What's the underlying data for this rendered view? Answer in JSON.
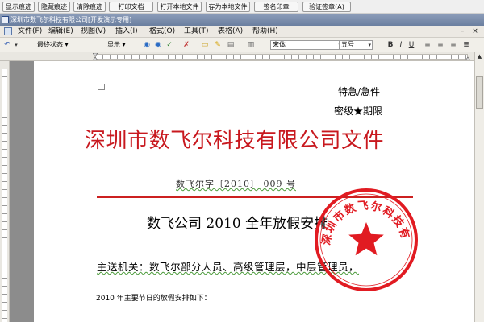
{
  "top_buttons": [
    "显示痕迹",
    "隐藏痕迹",
    "清除痕迹",
    "打印文档",
    "打开本地文件",
    "存为本地文件",
    "签名印章",
    "验证签章(A)"
  ],
  "window_title": "深圳市数飞尔科技有限公司[开发演示专用]",
  "menu": [
    "文件(F)",
    "编辑(E)",
    "视图(V)",
    "插入(I)",
    "格式(O)",
    "工具(T)",
    "表格(A)",
    "帮助(H)"
  ],
  "toolbar": {
    "track_state": "最终状态",
    "show_label": "显示",
    "font_name": "宋体",
    "font_size": "五号"
  },
  "document": {
    "urgency": "特急/急件",
    "secret_level": "密级★期限",
    "header_title": "深圳市数飞尔科技有限公司文件",
    "doc_number": "数飞尔字〔2010〕  009 号",
    "subject": "数飞公司 2010 全年放假安排",
    "recipients": "主送机关：数飞尔部分人员、高级管理层，中层管理员，",
    "body_line": "2010 年主要节日的放假安排如下：",
    "seal_text": "深圳市数飞尔科技有限公司",
    "seal_color": "#e11b22"
  },
  "colors": {
    "red_heading": "#c8181e",
    "red_rule": "#cc2020"
  }
}
